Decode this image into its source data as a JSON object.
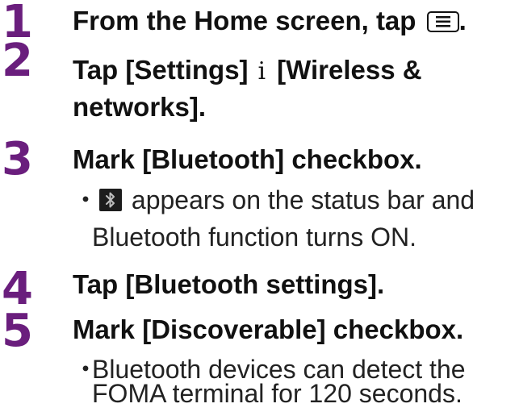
{
  "colors": {
    "step_number": "#6a1e7d",
    "text": "#111111"
  },
  "steps": [
    {
      "number": "1",
      "title_prefix": "From the Home screen, tap",
      "title_icon": "menu-key-icon",
      "title_suffix": "."
    },
    {
      "number": "2",
      "title_part1": "Tap [Settings]",
      "separator": "i",
      "title_part2": "[Wireless &",
      "title_line2": "networks]."
    },
    {
      "number": "3",
      "title": "Mark [Bluetooth] checkbox.",
      "bullet": "・",
      "note_icon": "bluetooth-status-icon",
      "note_line1": "appears on the status bar and",
      "note_line2": "Bluetooth function turns ON."
    },
    {
      "number": "4",
      "title": "Tap [Bluetooth settings]."
    },
    {
      "number": "5",
      "title": "Mark [Discoverable] checkbox.",
      "bullet": "・",
      "note_line1": "Bluetooth devices can detect the",
      "note_line2": "FOMA terminal for 120 seconds."
    }
  ]
}
